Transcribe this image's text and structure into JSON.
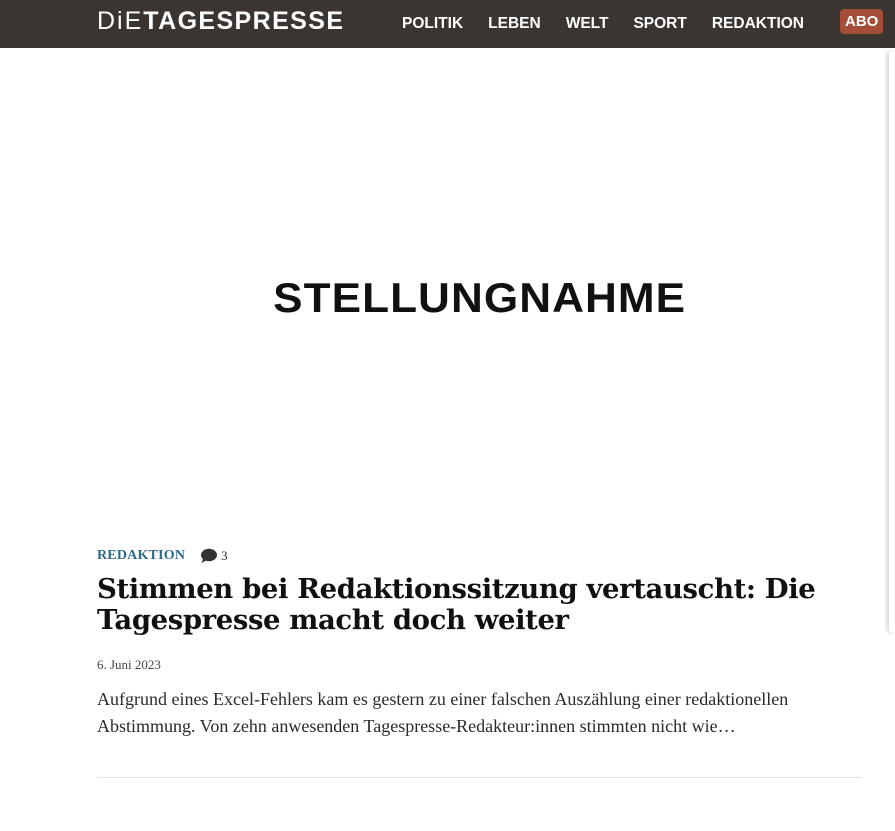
{
  "header": {
    "logo_prefix": "DiE",
    "logo_main": "TAGESPRESSE",
    "nav": [
      {
        "label": "POLITIK"
      },
      {
        "label": "LEBEN"
      },
      {
        "label": "WELT"
      },
      {
        "label": "SPORT"
      },
      {
        "label": "REDAKTION"
      }
    ],
    "abo_label": "ABO"
  },
  "article": {
    "image_text": "STELLUNGNAHME",
    "category": "REDAKTION",
    "comment_count": "3",
    "comment_icon": "speech-bubble-icon",
    "headline": "Stimmen bei Redaktionssitzung vertauscht: Die Tagespresse macht doch weiter",
    "date": "6. Juni 2023",
    "excerpt": "Aufgrund eines Excel-Fehlers kam es gestern zu einer falschen Auszählung einer redaktionellen Abstimmung. Von zehn anwesenden Tagespresse-Redakteur:innen stimmten nicht wie…"
  },
  "colors": {
    "header_bg": "#3b3532",
    "abo_bg": "#a44e3a",
    "category": "#2b6a8c"
  }
}
